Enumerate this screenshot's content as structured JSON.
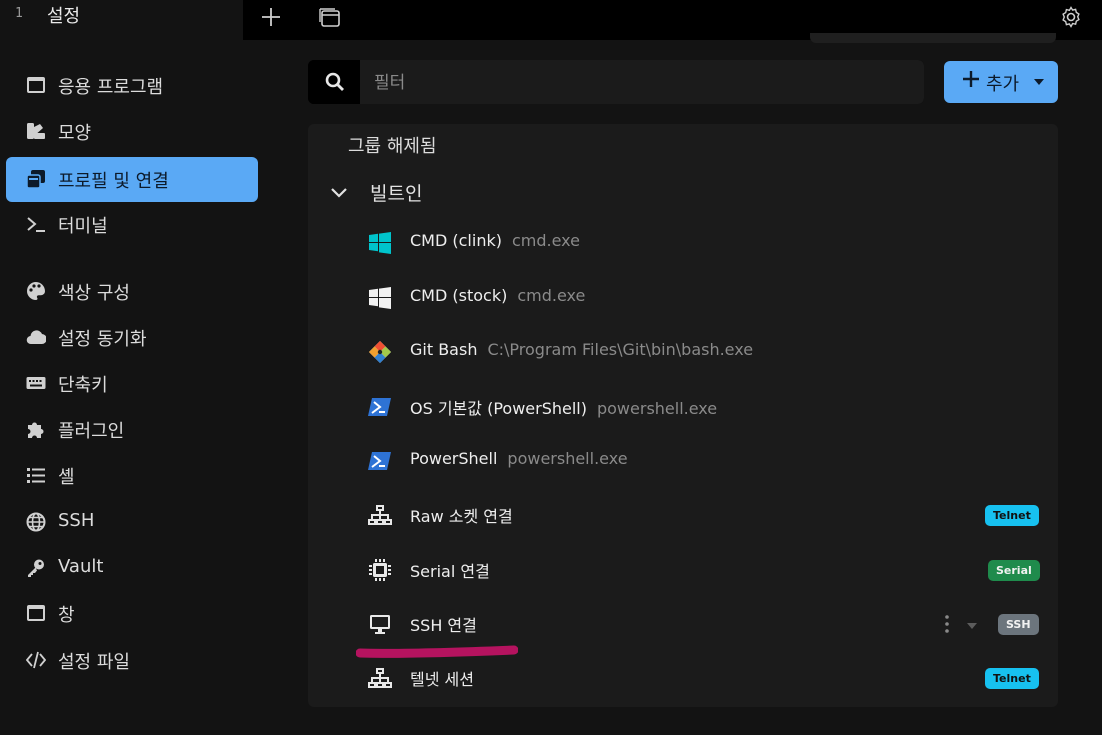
{
  "tab": {
    "number": "1",
    "title": "설정"
  },
  "sidebar": {
    "items": [
      {
        "label": "응용 프로그램",
        "icon": "window-icon"
      },
      {
        "label": "모양",
        "icon": "swatch-icon"
      },
      {
        "label": "프로필 및 연결",
        "icon": "profiles-icon",
        "active": true
      },
      {
        "label": "터미널",
        "icon": "terminal-icon"
      },
      {
        "label": "색상 구성",
        "icon": "palette-icon"
      },
      {
        "label": "설정 동기화",
        "icon": "cloud-icon"
      },
      {
        "label": "단축키",
        "icon": "keyboard-icon"
      },
      {
        "label": "플러그인",
        "icon": "puzzle-icon"
      },
      {
        "label": "셸",
        "icon": "list-icon"
      },
      {
        "label": "SSH",
        "icon": "globe-icon"
      },
      {
        "label": "Vault",
        "icon": "key-icon"
      },
      {
        "label": "창",
        "icon": "window-icon"
      },
      {
        "label": "설정 파일",
        "icon": "code-icon"
      }
    ]
  },
  "search": {
    "placeholder": "필터"
  },
  "add_button": {
    "label": "추가"
  },
  "groups": {
    "ungrouped": "그룹 해제됨",
    "builtin": "빌트인"
  },
  "profiles": [
    {
      "name": "CMD (clink)",
      "cmd": "cmd.exe",
      "icon": "windows-icon-teal"
    },
    {
      "name": "CMD (stock)",
      "cmd": "cmd.exe",
      "icon": "windows-icon-white"
    },
    {
      "name": "Git Bash",
      "cmd": "C:\\Program Files\\Git\\bin\\bash.exe",
      "icon": "git-icon"
    },
    {
      "name": "OS 기본값 (PowerShell)",
      "cmd": "powershell.exe",
      "icon": "powershell-icon"
    },
    {
      "name": "PowerShell",
      "cmd": "powershell.exe",
      "icon": "powershell-icon"
    },
    {
      "name": "Raw 소켓 연결",
      "cmd": "",
      "icon": "network-icon",
      "badge": "Telnet"
    },
    {
      "name": "Serial 연결",
      "cmd": "",
      "icon": "chip-icon",
      "badge": "Serial"
    },
    {
      "name": "SSH 연결",
      "cmd": "",
      "icon": "desktop-icon",
      "badge": "SSH"
    },
    {
      "name": "텔넷 세션",
      "cmd": "",
      "icon": "network-icon",
      "badge": "Telnet"
    }
  ],
  "colors": {
    "accent": "#5aa9f5",
    "telnet": "#17c1f0",
    "serial": "#1f8b4c",
    "ssh": "#6c757d",
    "highlight": "#b5135f"
  }
}
